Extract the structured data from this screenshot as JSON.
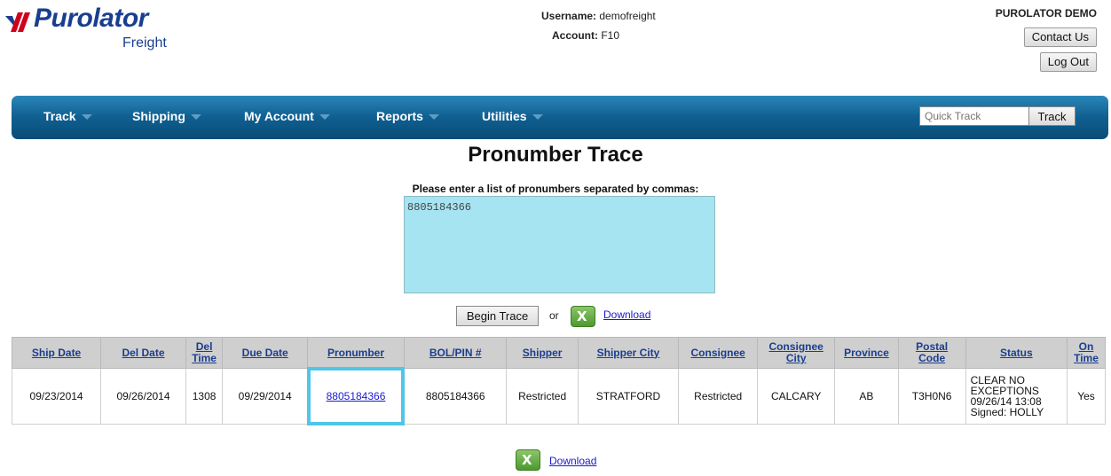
{
  "header": {
    "logo_text": "Purolator",
    "logo_sub": "Freight",
    "username_label": "Username:",
    "username": "demofreight",
    "account_label": "Account:",
    "account": "F10",
    "company": "PUROLATOR DEMO",
    "contact_label": "Contact Us",
    "logout_label": "Log Out"
  },
  "nav": {
    "items": [
      "Track",
      "Shipping",
      "My Account",
      "Reports",
      "Utilities"
    ],
    "quick_track_placeholder": "Quick Track",
    "quick_track_button": "Track"
  },
  "page": {
    "title": "Pronumber Trace",
    "instructions": "Please enter a list of pronumbers separated by commas:",
    "pronumbers_value": "8805184366",
    "begin_trace_label": "Begin Trace",
    "or_text": "or",
    "download_label": "Download"
  },
  "table": {
    "headers": [
      "Ship Date",
      "Del Date",
      "Del Time",
      "Due Date",
      "Pronumber",
      "BOL/PIN #",
      "Shipper",
      "Shipper City",
      "Consignee",
      "Consignee City",
      "Province",
      "Postal Code",
      "Status",
      "On Time"
    ],
    "rows": [
      {
        "ship_date": "09/23/2014",
        "del_date": "09/26/2014",
        "del_time": "1308",
        "due_date": "09/29/2014",
        "pronumber": "8805184366",
        "bol_pin": "8805184366",
        "shipper": "Restricted",
        "shipper_city": "STRATFORD",
        "consignee": "Restricted",
        "consignee_city": "CALCARY",
        "province": "AB",
        "postal_code": "T3H0N6",
        "status_line1": "CLEAR NO",
        "status_line2": "EXCEPTIONS",
        "status_line3": "09/26/14 13:08",
        "status_line4": "Signed: HOLLY",
        "on_time": "Yes"
      }
    ]
  },
  "colors": {
    "nav_bg": "#0f5f90",
    "textarea_bg": "#a6e4f2",
    "highlight": "#4fc6e8",
    "link": "#1a1ad0",
    "header_text": "#1a3e8f"
  },
  "icons": [
    "purolator-logo-icon",
    "caret-down-icon",
    "excel-icon"
  ]
}
